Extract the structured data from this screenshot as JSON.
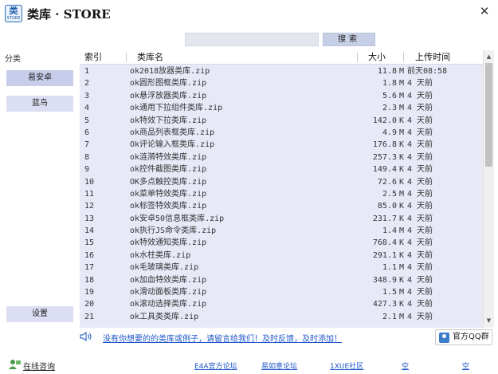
{
  "app": {
    "logo_top": "类",
    "logo_bottom": "STORE",
    "title": "类库 · STORE",
    "close_glyph": "✕"
  },
  "search": {
    "value": "",
    "placeholder": "",
    "button_label": "搜索"
  },
  "sidebar": {
    "heading": "分类",
    "items": [
      {
        "label": "易安卓"
      },
      {
        "label": "蓝鸟"
      }
    ],
    "settings_label": "设置"
  },
  "table": {
    "columns": [
      {
        "label": "索引"
      },
      {
        "label": "类库名"
      },
      {
        "label": "大小"
      },
      {
        "label": "上传时间"
      }
    ],
    "rows": [
      {
        "idx": "1",
        "name": "ok2018放器类库.zip",
        "size": "11.8",
        "unit": "M",
        "time": "前天08:58"
      },
      {
        "idx": "2",
        "name": "ok圆形图框类库.zip",
        "size": "1.8",
        "unit": "M",
        "time": "4 天前"
      },
      {
        "idx": "3",
        "name": "ok悬浮放器类库.zip",
        "size": "5.6",
        "unit": "M",
        "time": "4 天前"
      },
      {
        "idx": "4",
        "name": "ok通用下拉组件类库.zip",
        "size": "2.3",
        "unit": "M",
        "time": "4 天前"
      },
      {
        "idx": "5",
        "name": "ok特效下拉类库.zip",
        "size": "142.0",
        "unit": "K",
        "time": "4 天前"
      },
      {
        "idx": "6",
        "name": "ok商品列表框类库.zip",
        "size": "4.9",
        "unit": "M",
        "time": "4 天前"
      },
      {
        "idx": "7",
        "name": "Ok评论输入框类库.zip",
        "size": "176.8",
        "unit": "K",
        "time": "4 天前"
      },
      {
        "idx": "8",
        "name": "ok涟漪特效类库.zip",
        "size": "257.3",
        "unit": "K",
        "time": "4 天前"
      },
      {
        "idx": "9",
        "name": "ok控件截图类库.zip",
        "size": "149.4",
        "unit": "K",
        "time": "4 天前"
      },
      {
        "idx": "10",
        "name": "OK多点触控类库.zip",
        "size": "72.6",
        "unit": "K",
        "time": "4 天前"
      },
      {
        "idx": "11",
        "name": "ok菜单特效类库.zip",
        "size": "2.5",
        "unit": "M",
        "time": "4 天前"
      },
      {
        "idx": "12",
        "name": "ok标签特效类库.zip",
        "size": "85.0",
        "unit": "K",
        "time": "4 天前"
      },
      {
        "idx": "13",
        "name": "ok安卓50信息框类库.zip",
        "size": "231.7",
        "unit": "K",
        "time": "4 天前"
      },
      {
        "idx": "14",
        "name": "ok执行JS命令类库.zip",
        "size": "1.4",
        "unit": "M",
        "time": "4 天前"
      },
      {
        "idx": "15",
        "name": "ok特效通知类库.zip",
        "size": "768.4",
        "unit": "K",
        "time": "4 天前"
      },
      {
        "idx": "16",
        "name": "ok水柱类库.zip",
        "size": "291.1",
        "unit": "K",
        "time": "4 天前"
      },
      {
        "idx": "17",
        "name": "ok毛玻璃类库.zip",
        "size": "1.1",
        "unit": "M",
        "time": "4 天前"
      },
      {
        "idx": "18",
        "name": "ok加血特效类库.zip",
        "size": "348.9",
        "unit": "K",
        "time": "4 天前"
      },
      {
        "idx": "19",
        "name": "ok滑动面板类库.zip",
        "size": "1.5",
        "unit": "M",
        "time": "4 天前"
      },
      {
        "idx": "20",
        "name": "ok滚动选择类库.zip",
        "size": "427.3",
        "unit": "K",
        "time": "4 天前"
      },
      {
        "idx": "21",
        "name": "ok工具类类库.zip",
        "size": "2.1",
        "unit": "M",
        "time": "4 天前"
      }
    ],
    "scroll_up_glyph": "▲",
    "scroll_down_glyph": "▼"
  },
  "notice": {
    "icon": "speaker-icon",
    "text": "没有你想要的的类库或例子，请留言给我们！及时反馈，及时添加！"
  },
  "qq_button": {
    "icon": "qq-icon",
    "label": "官方QQ群"
  },
  "footer": {
    "online_label": "在线咨询",
    "links": [
      {
        "label": "E4A官方论坛"
      },
      {
        "label": "易如意论坛"
      },
      {
        "label": "1XUE社区"
      },
      {
        "label": "空"
      },
      {
        "label": "空"
      }
    ]
  },
  "colors": {
    "table_bg": "#e8e9f7",
    "side_button": "#dcdff3",
    "link": "#1f57c8",
    "accent": "#2a6fb8"
  }
}
